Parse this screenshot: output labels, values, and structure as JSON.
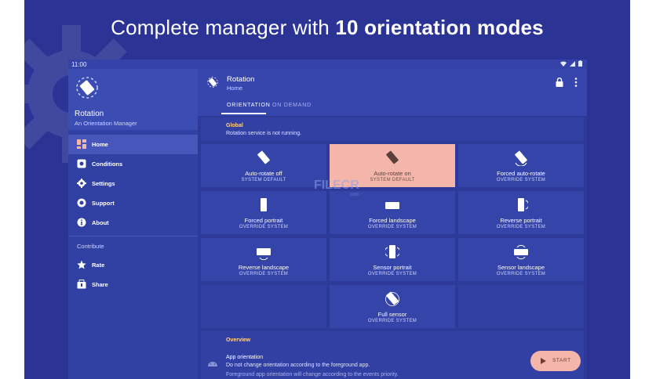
{
  "headline": {
    "normal": "Complete manager with ",
    "bold": "10 orientation modes"
  },
  "statusbar": {
    "time": "11:00",
    "icons": "wifi-icon signal-icon battery-icon"
  },
  "drawer": {
    "app_name": "Rotation",
    "app_tagline": "An Orientation Manager",
    "items": [
      {
        "label": "Home",
        "icon": "dashboard-icon",
        "active": true
      },
      {
        "label": "Conditions",
        "icon": "conditions-icon",
        "active": false
      },
      {
        "label": "Settings",
        "icon": "gear-icon",
        "active": false
      },
      {
        "label": "Support",
        "icon": "support-icon",
        "active": false
      },
      {
        "label": "About",
        "icon": "info-icon",
        "active": false
      }
    ],
    "section_label": "Contribute",
    "contribute_items": [
      {
        "label": "Rate",
        "icon": "star-icon"
      },
      {
        "label": "Share",
        "icon": "share-icon"
      }
    ]
  },
  "appbar": {
    "title": "Rotation",
    "subtitle": "Home",
    "tabs": [
      {
        "label": "ORIENTATION",
        "active": true
      },
      {
        "label": "ON DEMAND",
        "active": false
      }
    ]
  },
  "global": {
    "heading": "Global",
    "text": "Rotation service is not running."
  },
  "modes": [
    {
      "title": "Auto-rotate off",
      "sub": "SYSTEM DEFAULT",
      "selected": false
    },
    {
      "title": "Auto-rotate on",
      "sub": "SYSTEM DEFAULT",
      "selected": true
    },
    {
      "title": "Forced auto-rotate",
      "sub": "OVERRIDE SYSTEM",
      "selected": false
    },
    {
      "title": "Forced portrait",
      "sub": "OVERRIDE SYSTEM",
      "selected": false
    },
    {
      "title": "Forced landscape",
      "sub": "OVERRIDE SYSTEM",
      "selected": false
    },
    {
      "title": "Reverse portrait",
      "sub": "OVERRIDE SYSTEM",
      "selected": false
    },
    {
      "title": "Reverse landscape",
      "sub": "OVERRIDE SYSTEM",
      "selected": false
    },
    {
      "title": "Sensor portrait",
      "sub": "OVERRIDE SYSTEM",
      "selected": false
    },
    {
      "title": "Sensor landscape",
      "sub": "OVERRIDE SYSTEM",
      "selected": false
    },
    {
      "title": "Full sensor",
      "sub": "OVERRIDE SYSTEM",
      "selected": false
    }
  ],
  "overview": {
    "heading": "Overview",
    "item_title": "App orientation",
    "item_text": "Do not change orientation according to the foreground app.",
    "item_note": "Foreground app orientation will change according to the events priority."
  },
  "start_button": {
    "label": "START"
  },
  "watermark": {
    "main": "FILECR",
    "sub": ".com"
  },
  "colors": {
    "background": "#2b3494",
    "accent": "#f4b6aa",
    "heading_accent": "#ffd38a"
  }
}
